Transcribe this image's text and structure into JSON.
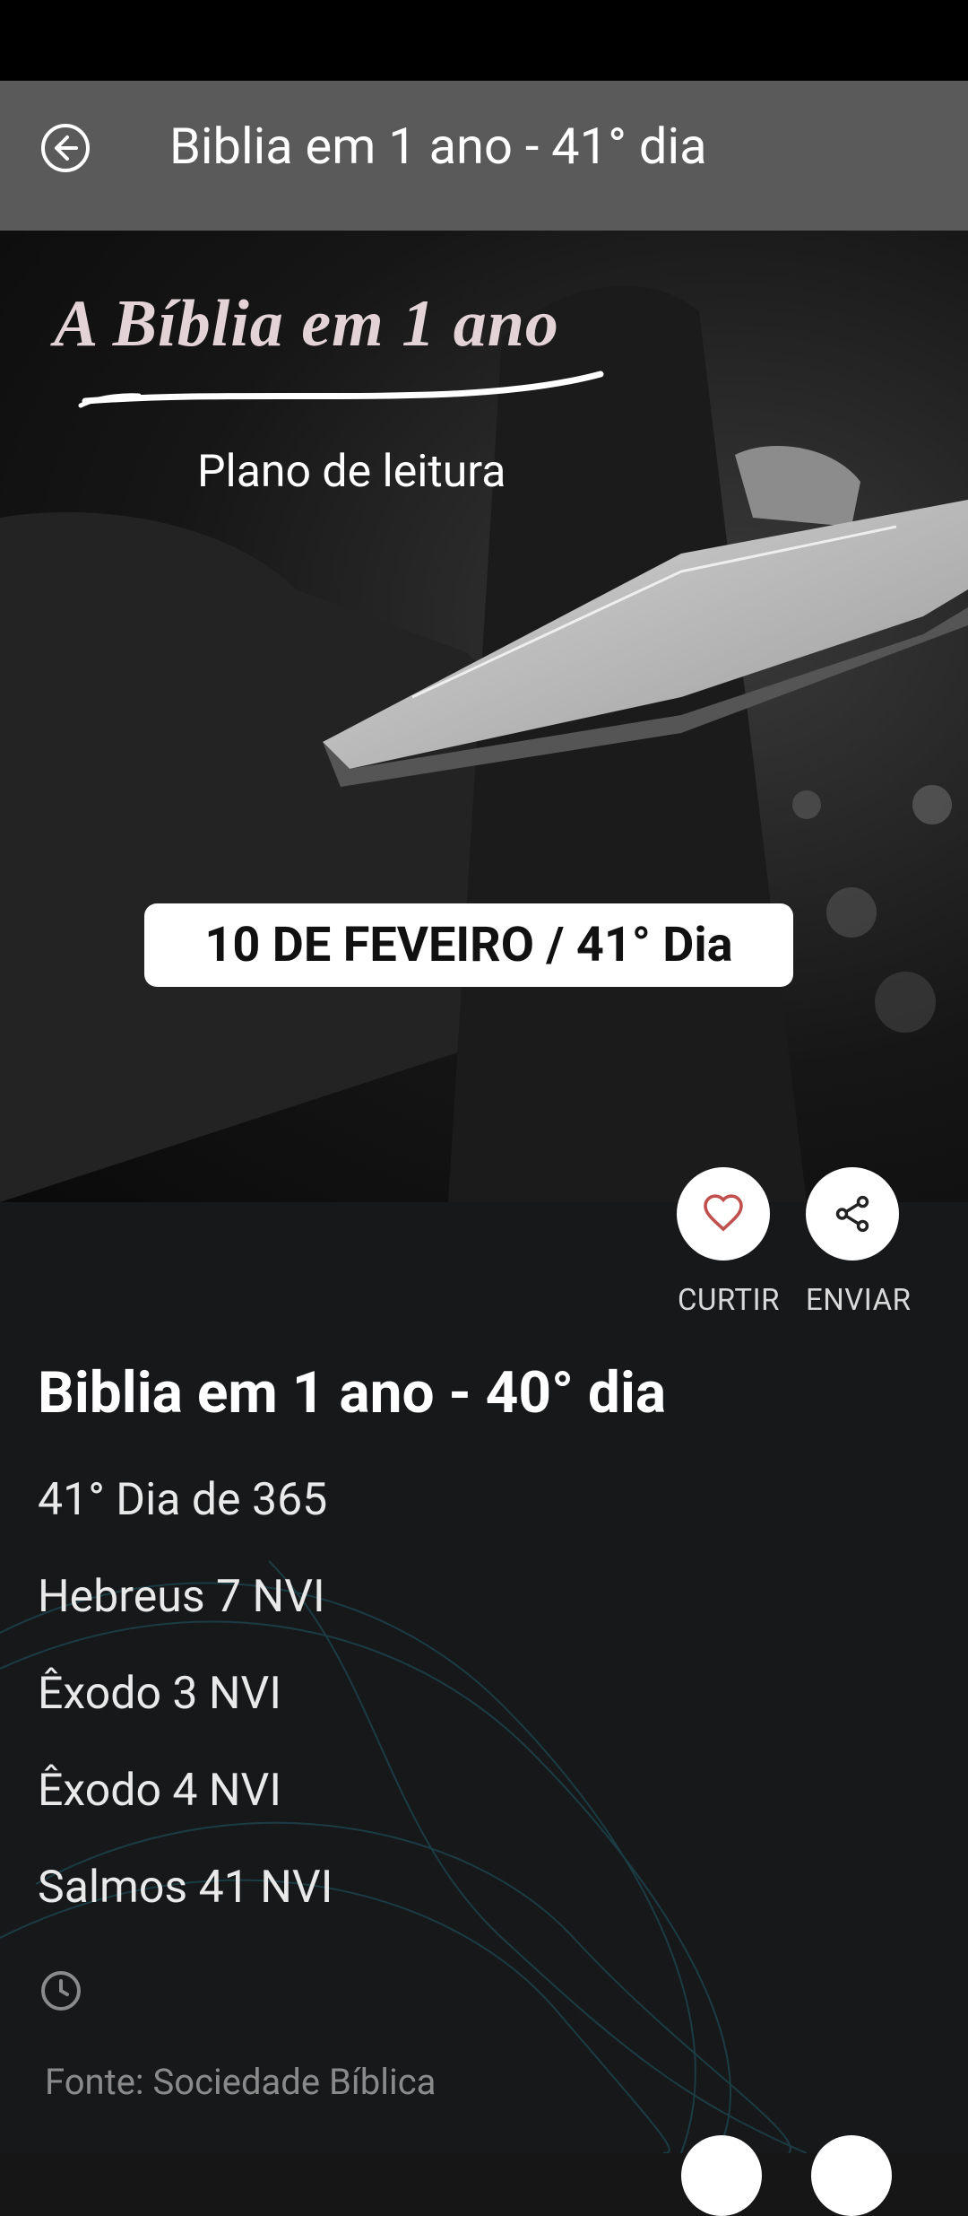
{
  "header": {
    "title": "Biblia em 1 ano - 41° dia",
    "back_icon": "arrow-left-circle-icon"
  },
  "hero": {
    "title": "A Bíblia em 1 ano",
    "subtitle": "Plano de leitura",
    "date_label": "10 DE FEVEIRO / 41° Dia"
  },
  "actions": {
    "like_label": "CURTIR",
    "share_label": "ENVIAR",
    "like_icon": "heart-outline-icon",
    "share_icon": "share-icon"
  },
  "post": {
    "title": "Biblia em 1 ano - 40° dia",
    "lines": [
      "41° Dia de 365",
      "Hebreus 7 NVI",
      "Êxodo 3 NVI",
      "Êxodo 4 NVI",
      "Salmos 41 NVI"
    ],
    "source": "Fonte: Sociedade Bíblica"
  },
  "colors": {
    "app_bar": "#5a5a5a",
    "heart": "#c0504d",
    "background": "#161616"
  }
}
